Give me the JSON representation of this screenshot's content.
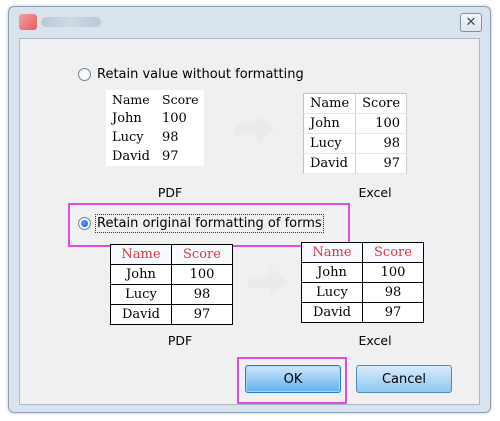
{
  "window": {
    "close_glyph": "✕"
  },
  "options": {
    "value_only_label": "Retain value without formatting",
    "keep_format_label": "Retain original formatting of forms",
    "selected": "keep_format"
  },
  "captions": {
    "pdf": "PDF",
    "excel": "Excel"
  },
  "table": {
    "headers": [
      "Name",
      "Score"
    ],
    "rows": [
      [
        "John",
        "100"
      ],
      [
        "Lucy",
        "98"
      ],
      [
        "David",
        "97"
      ]
    ]
  },
  "buttons": {
    "ok": "OK",
    "cancel": "Cancel"
  },
  "colors": {
    "highlight": "#e04ce0",
    "header_text": "#e0323a",
    "ok_button": "#5fb0ef"
  }
}
